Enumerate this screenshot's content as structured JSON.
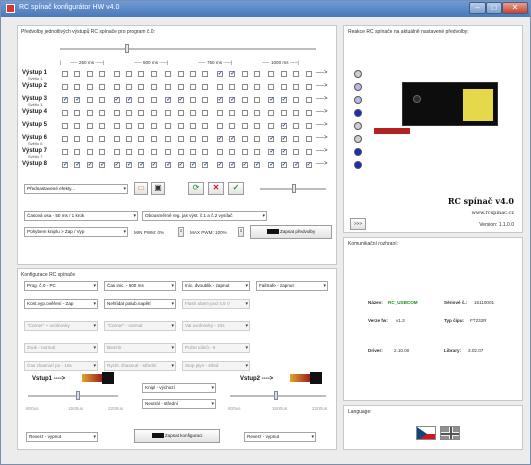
{
  "window": {
    "title": "RC spínač konfigurátor HW v4.0",
    "min_glyph": "–",
    "max_glyph": "□",
    "close_glyph": "✕"
  },
  "left_panel": {
    "title": "Předvolby jednotlivých výstupů RC spínače pro program č.0:",
    "timeline": [
      "250 ms",
      "500 ms",
      "750 ms",
      "1000 ms"
    ],
    "outputs": [
      {
        "label": "Výstup 1",
        "sub": "Světlo 1",
        "pattern": [
          0,
          0,
          0,
          0,
          0,
          0,
          0,
          0,
          0,
          0,
          0,
          0,
          1,
          1,
          0,
          0,
          0,
          0,
          0,
          0
        ]
      },
      {
        "label": "Výstup 2",
        "sub": "",
        "pattern": [
          0,
          0,
          0,
          0,
          0,
          0,
          0,
          0,
          0,
          0,
          0,
          0,
          0,
          0,
          0,
          0,
          0,
          0,
          0,
          0
        ]
      },
      {
        "label": "Výstup 3",
        "sub": "Světlo 3",
        "pattern": [
          1,
          1,
          0,
          0,
          1,
          1,
          0,
          0,
          1,
          1,
          0,
          0,
          1,
          1,
          0,
          0,
          1,
          1,
          0,
          0
        ]
      },
      {
        "label": "Výstup 4",
        "sub": "",
        "pattern": [
          0,
          0,
          0,
          0,
          0,
          0,
          0,
          0,
          0,
          0,
          0,
          0,
          0,
          0,
          0,
          0,
          0,
          0,
          0,
          0
        ]
      },
      {
        "label": "Výstup 5",
        "sub": "",
        "pattern": [
          0,
          0,
          0,
          0,
          0,
          0,
          0,
          0,
          0,
          0,
          0,
          0,
          0,
          0,
          0,
          0,
          0,
          1,
          0,
          0
        ]
      },
      {
        "label": "Výstup 6",
        "sub": "Světlo 6",
        "pattern": [
          0,
          0,
          0,
          0,
          0,
          0,
          0,
          0,
          0,
          0,
          0,
          0,
          1,
          1,
          0,
          0,
          1,
          1,
          0,
          0
        ]
      },
      {
        "label": "Výstup 7",
        "sub": "Světlo 7",
        "pattern": [
          0,
          0,
          0,
          0,
          0,
          0,
          0,
          0,
          0,
          0,
          0,
          0,
          0,
          0,
          0,
          0,
          1,
          1,
          0,
          0
        ]
      },
      {
        "label": "Výstup 8",
        "sub": "",
        "pattern": [
          1,
          1,
          1,
          1,
          1,
          1,
          1,
          1,
          1,
          1,
          1,
          1,
          1,
          1,
          1,
          1,
          1,
          1,
          1,
          1
        ]
      }
    ],
    "arrow": "---->",
    "presets_combo": "Přednastavené efekty...",
    "speed_combo": "Časová osa - 50 ms / 1 krok",
    "mode_combo": "Obousměrně reg. jas výst. č.1 a č.2 vysílač",
    "button_combo": "Pohybem kniplu > Zap / Vyp",
    "min_pwm": "MIN PWM: 0%",
    "max_pwm": "MAX PWM: 100%",
    "write_presets": "Zapsat předvolby"
  },
  "right_panel": {
    "title": "Reakce RC spínače na aktuálně nastavené předvolby:",
    "led_colors": [
      "#cfcfcf",
      "#b8b8e8",
      "#b8b8e8",
      "#1c2bbd",
      "#cfcfcf",
      "#cfcfcf",
      "#1c2bbd",
      "#1c2bbd"
    ],
    "device_name": "RC spínač v4.0",
    "website": "www.rcspinac.cz",
    "version": "Version: 1.1.0.0",
    "more_button": ">>>"
  },
  "config": {
    "title": "Konfigurace RC spínače",
    "rows": [
      [
        "Prog. č.0 - PC",
        "Čas inic. - 500 ms",
        "Inic. dvoublik - zapnut",
        "FailSafe - zapnut"
      ],
      [
        "Kont.vyp.ověření - Zap",
        "Nehlídat palub.napětí",
        "Flash alarm pod 4,5 V"
      ],
      [
        "\"Corner\" + uvolnovky",
        "\"Corner\" - normal",
        "Vai uvolnovky - 10s"
      ],
      [
        "Zvuk - normal",
        "Benzín",
        "Počet válců - 6"
      ],
      [
        "Čas zhasnutí po - 10s",
        "Rychl. zhasnutí - střední",
        "Stop plyn - střed"
      ]
    ],
    "input1": "Vstup1 ---->",
    "input2": "Vstup2 ---->",
    "knipl_combo": "Knipl - výchozí",
    "neutral_combo": "Neutrál - střední",
    "ticks": [
      "800us",
      "1500us",
      "2200us"
    ],
    "reverz1": "Reverz - vypnut",
    "reverz2": "Reverz - vypnut",
    "write_config": "Zapsat konfiguraci"
  },
  "comm": {
    "title": "Komunikační rozhraní:",
    "name_label": "Název:",
    "name_value": "RC_USBCOM",
    "serial_label": "Sériové č.:",
    "serial_value": "15110001",
    "fw_label": "Verze fw:",
    "fw_value": "v1.3",
    "chip_label": "Typ čipu:",
    "chip_value": "FT232R",
    "driver_label": "Driver:",
    "driver_value": "2.10.00",
    "library_label": "Library:",
    "library_value": "3.02.07"
  },
  "language": {
    "title": "Language:"
  }
}
